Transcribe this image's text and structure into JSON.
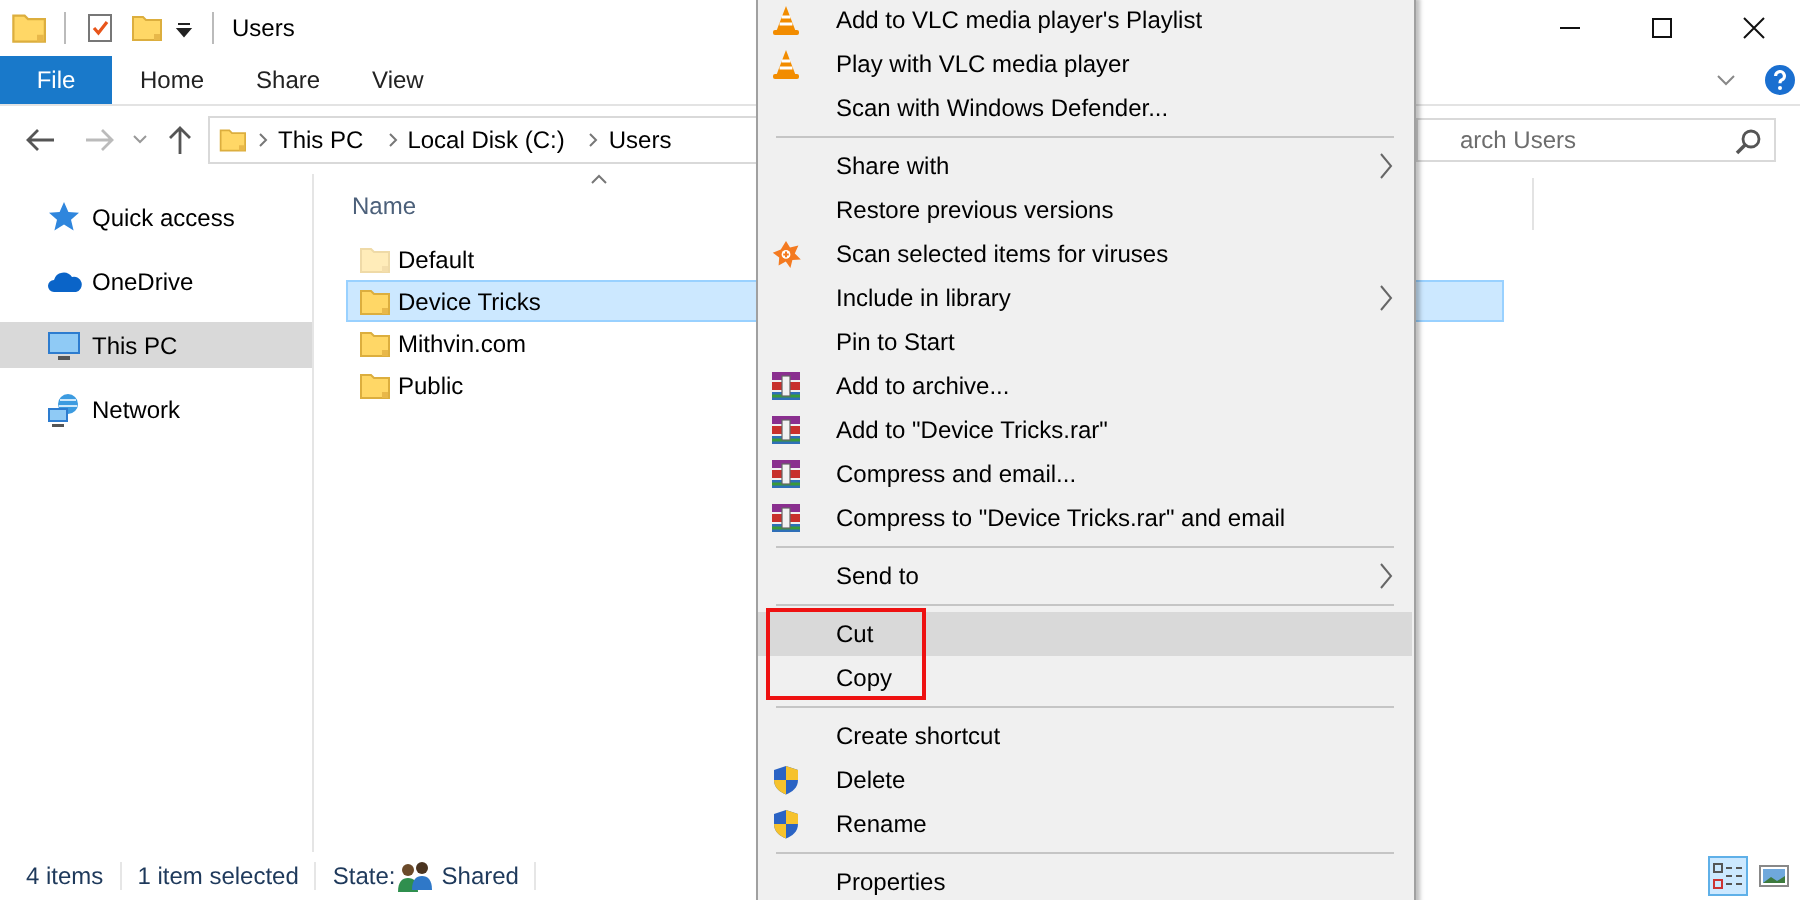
{
  "window": {
    "title": "Users"
  },
  "ribbon": {
    "file_button": "File",
    "tabs": [
      {
        "label": "Home",
        "selected": false
      },
      {
        "label": "Share",
        "selected": false
      },
      {
        "label": "View",
        "selected": false
      }
    ]
  },
  "address_bar": {
    "path": [
      "This PC",
      "Local Disk (C:)",
      "Users"
    ]
  },
  "search": {
    "placeholder": "arch Users"
  },
  "sidebar": {
    "items": [
      {
        "kind": "star",
        "label": "Quick access",
        "selected": false
      },
      {
        "kind": "cloud",
        "label": "OneDrive",
        "selected": false
      },
      {
        "kind": "computer",
        "label": "This PC",
        "selected": true
      },
      {
        "kind": "network",
        "label": "Network",
        "selected": false
      }
    ]
  },
  "file_list": {
    "column": "Name",
    "rows": [
      {
        "name": "Default",
        "hidden": true,
        "selected": false
      },
      {
        "name": "Device Tricks",
        "hidden": false,
        "selected": true
      },
      {
        "name": "Mithvin.com",
        "hidden": false,
        "selected": false
      },
      {
        "name": "Public",
        "hidden": false,
        "selected": false
      }
    ]
  },
  "status_bar": {
    "count": "4 items",
    "selection": "1 item selected",
    "state_label": "State:",
    "state_value": "Shared"
  },
  "view_buttons": [
    {
      "kind": "details",
      "selected": true
    },
    {
      "kind": "thumbnails",
      "selected": false
    }
  ],
  "context_menu": {
    "items": [
      {
        "kind": "cone",
        "label": "Add to VLC media player's Playlist",
        "submenu": false,
        "selected": false,
        "framed": false
      },
      {
        "kind": "cone",
        "label": "Play with VLC media player",
        "submenu": false,
        "selected": false,
        "framed": false
      },
      {
        "kind": "plain",
        "label": "Scan with Windows Defender...",
        "submenu": false,
        "selected": false,
        "framed": false
      },
      {
        "kind": "separator"
      },
      {
        "kind": "plain",
        "label": "Share with",
        "submenu": true,
        "selected": false,
        "framed": false
      },
      {
        "kind": "plain",
        "label": "Restore previous versions",
        "submenu": false,
        "selected": false,
        "framed": false
      },
      {
        "kind": "splat",
        "label": "Scan selected items for viruses",
        "submenu": false,
        "selected": false,
        "framed": false
      },
      {
        "kind": "plain",
        "label": "Include in library",
        "submenu": true,
        "selected": false,
        "framed": false
      },
      {
        "kind": "plain",
        "label": "Pin to Start",
        "submenu": false,
        "selected": false,
        "framed": false
      },
      {
        "kind": "archive",
        "label": "Add to archive...",
        "submenu": false,
        "selected": false,
        "framed": false
      },
      {
        "kind": "archive",
        "label": "Add to \"Device Tricks.rar\"",
        "submenu": false,
        "selected": false,
        "framed": false
      },
      {
        "kind": "archive",
        "label": "Compress and email...",
        "submenu": false,
        "selected": false,
        "framed": false
      },
      {
        "kind": "archive",
        "label": "Compress to \"Device Tricks.rar\" and email",
        "submenu": false,
        "selected": false,
        "framed": false
      },
      {
        "kind": "separator"
      },
      {
        "kind": "plain",
        "label": "Send to",
        "submenu": true,
        "selected": false,
        "framed": false
      },
      {
        "kind": "separator"
      },
      {
        "kind": "plain",
        "label": "Cut",
        "submenu": false,
        "selected": true,
        "framed": true
      },
      {
        "kind": "plain",
        "label": "Copy",
        "submenu": false,
        "selected": false,
        "framed": true
      },
      {
        "kind": "separator"
      },
      {
        "kind": "plain",
        "label": "Create shortcut",
        "submenu": false,
        "selected": false,
        "framed": false
      },
      {
        "kind": "shield",
        "label": "Delete",
        "submenu": false,
        "selected": false,
        "framed": false
      },
      {
        "kind": "shield",
        "label": "Rename",
        "submenu": false,
        "selected": false,
        "framed": false
      },
      {
        "kind": "separator"
      },
      {
        "kind": "plain",
        "label": "Properties",
        "submenu": false,
        "selected": false,
        "framed": false
      }
    ]
  }
}
